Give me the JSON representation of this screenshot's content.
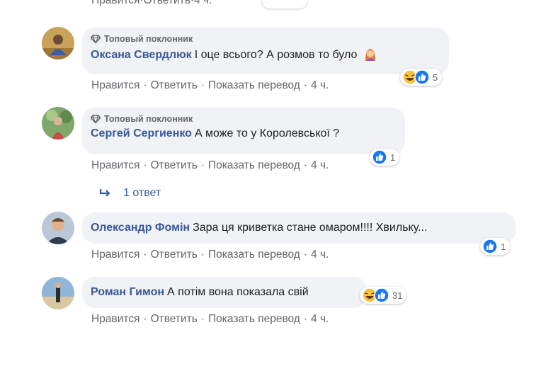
{
  "actions": {
    "like": "Нравится",
    "reply": "Ответить",
    "translate": "Показать перевод",
    "separator": "·"
  },
  "icons": {
    "gem": "gem-icon",
    "haha": "haha-emoji-icon",
    "like": "like-reaction-icon",
    "reply_arrow": "reply-arrow-icon",
    "woman": "woman-emoji-icon"
  },
  "colors": {
    "author": "#385898",
    "muted": "#65676b",
    "bubble": "#f0f2f5",
    "like_blue": "#1877f2",
    "haha_yellow": "#f7c23d"
  },
  "partial_top": {
    "like": "Нравится",
    "reply": "Ответить",
    "time": "4 ч."
  },
  "comments": [
    {
      "badge": "Топовый поклонник",
      "author": "Оксана Свердлюк",
      "text": "І оце всього? А розмов то було",
      "time": "4 ч.",
      "reaction_count": "5"
    },
    {
      "badge": "Топовый поклонник",
      "author": "Сергей Сергиенко",
      "text": "А може то у Королевської ?",
      "time": "4 ч.",
      "reaction_count": "1",
      "replies_label": "1 ответ"
    },
    {
      "author": "Олександр Фомін",
      "text": "Зара ця криветка стане омаром!!!! Хвильку...",
      "time": "4 ч.",
      "reaction_count": "1"
    },
    {
      "author": "Роман Гимон",
      "text": "А потім вона показала свій",
      "time": "4 ч.",
      "reaction_count": "31"
    }
  ]
}
